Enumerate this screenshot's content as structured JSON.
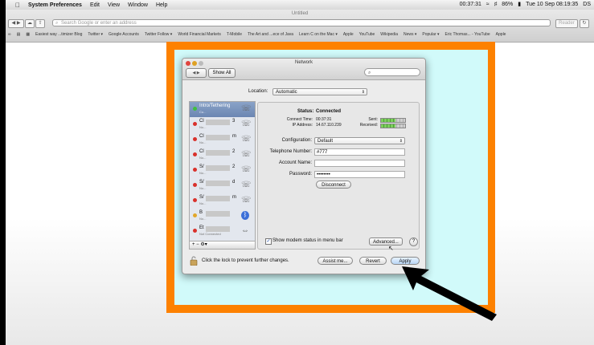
{
  "menubar": {
    "apple": "",
    "items": [
      "System Preferences",
      "Edit",
      "View",
      "Window",
      "Help"
    ],
    "status": {
      "clock": "Tue 10 Sep 08:19:35",
      "user": "DS",
      "battery": "86%",
      "timer": "00:37:31"
    }
  },
  "browser": {
    "title": "Untitled",
    "address_placeholder": "Search Google or enter an address",
    "reader": "Reader",
    "bookmarks": [
      "Easiest way ...timizer Blog",
      "Twitter ▾",
      "Google Accounts",
      "Twitter Follow ▾",
      "World Financial Markets",
      "T-Mobile",
      "The Art and ...ece of Java",
      "Learn C on the Mac ▾",
      "Apple",
      "YouTube",
      "Wikipedia",
      "News ▾",
      "Popular ▾",
      "Eric Thomas... - YouTube",
      "Apple"
    ]
  },
  "network": {
    "title": "Network",
    "show_all": "Show All",
    "location_label": "Location:",
    "location_value": "Automatic",
    "services": [
      {
        "name": "Intro/Tethering",
        "sub": "Co...",
        "status": "green",
        "icon": "phone-icon",
        "selected": true
      },
      {
        "name": "Cl",
        "suffix": "3",
        "sub": "No...",
        "status": "red",
        "icon": "phone-icon"
      },
      {
        "name": "Cl",
        "suffix": "m",
        "sub": "No...",
        "status": "red",
        "icon": "phone-icon"
      },
      {
        "name": "Cl",
        "suffix": "2",
        "sub": "No...",
        "status": "red",
        "icon": "phone-icon"
      },
      {
        "name": "S/",
        "suffix": "2",
        "sub": "No...",
        "status": "red",
        "icon": "phone-icon"
      },
      {
        "name": "S/",
        "suffix": "d",
        "sub": "No...",
        "status": "red",
        "icon": "phone-icon"
      },
      {
        "name": "S/",
        "suffix": "m",
        "sub": "No...",
        "status": "red",
        "icon": "phone-icon"
      },
      {
        "name": "B",
        "suffix": "",
        "sub": "No...",
        "status": "amber",
        "icon": "bluetooth-icon"
      },
      {
        "name": "Et",
        "suffix": "",
        "sub": "Not Connected",
        "status": "red",
        "icon": "ethernet-icon"
      }
    ],
    "list_controls": "+  −  ⚙▾",
    "status_label": "Status:",
    "status_value": "Connected",
    "connect_time_label": "Connect Time:",
    "connect_time_value": "00:37:31",
    "ip_label": "IP Address:",
    "ip_value": "14.67.110.239",
    "sent_label": "Sent:",
    "received_label": "Received:",
    "sent_level": 0.6,
    "received_level": 0.6,
    "configuration_label": "Configuration:",
    "configuration_value": "Default",
    "telephone_label": "Telephone Number:",
    "telephone_value": "#777",
    "account_label": "Account Name:",
    "account_value": "",
    "password_label": "Password:",
    "password_value": "••••••••",
    "disconnect": "Disconnect",
    "modem_status_label": "Show modem status in menu bar",
    "modem_status_checked": true,
    "advanced": "Advanced...",
    "help": "?",
    "lock_text": "Click the lock to prevent further changes.",
    "assist_me": "Assist me...",
    "revert": "Revert",
    "apply": "Apply"
  },
  "colors": {
    "highlight_border": "#fd8100",
    "highlight_fill": "#d1fafa",
    "arrow": "#000000"
  }
}
